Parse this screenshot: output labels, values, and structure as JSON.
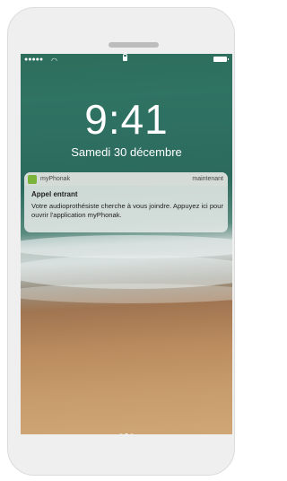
{
  "status_bar": {
    "signal": "●●●●●",
    "wifi": "◠",
    "lock": "lock-icon",
    "battery": "battery-icon"
  },
  "lock_screen": {
    "time": "9:41",
    "date": "Samedi 30 décembre"
  },
  "notification": {
    "app_name": "myPhonak",
    "timestamp": "maintenant",
    "title": "Appel entrant",
    "body": "Votre audioprothésiste cherche à vous joindre. Appuyez ici pour ouvrir l'application myPhonak."
  },
  "page_indicator": {
    "pages": 3,
    "active_index": 1
  },
  "colors": {
    "app_icon": "#7bb33b",
    "text": "#ffffff"
  }
}
